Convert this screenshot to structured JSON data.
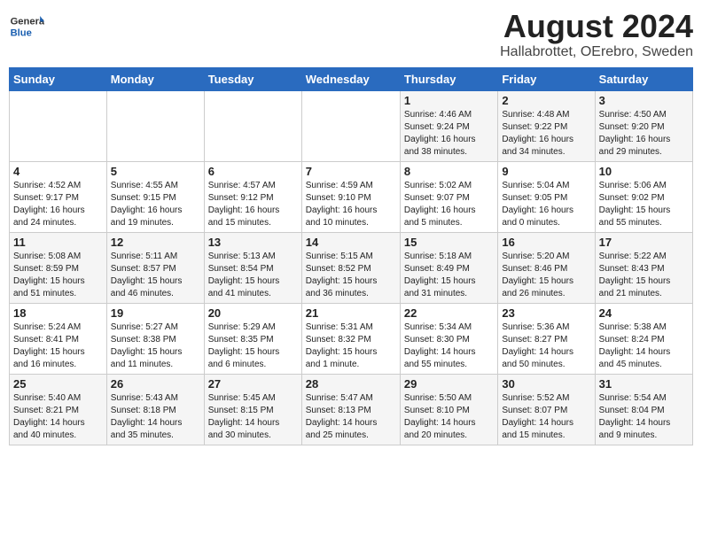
{
  "header": {
    "logo_general": "General",
    "logo_blue": "Blue",
    "title": "August 2024",
    "subtitle": "Hallabrottet, OErebro, Sweden"
  },
  "weekdays": [
    "Sunday",
    "Monday",
    "Tuesday",
    "Wednesday",
    "Thursday",
    "Friday",
    "Saturday"
  ],
  "weeks": [
    [
      {
        "day": "",
        "info": ""
      },
      {
        "day": "",
        "info": ""
      },
      {
        "day": "",
        "info": ""
      },
      {
        "day": "",
        "info": ""
      },
      {
        "day": "1",
        "info": "Sunrise: 4:46 AM\nSunset: 9:24 PM\nDaylight: 16 hours\nand 38 minutes."
      },
      {
        "day": "2",
        "info": "Sunrise: 4:48 AM\nSunset: 9:22 PM\nDaylight: 16 hours\nand 34 minutes."
      },
      {
        "day": "3",
        "info": "Sunrise: 4:50 AM\nSunset: 9:20 PM\nDaylight: 16 hours\nand 29 minutes."
      }
    ],
    [
      {
        "day": "4",
        "info": "Sunrise: 4:52 AM\nSunset: 9:17 PM\nDaylight: 16 hours\nand 24 minutes."
      },
      {
        "day": "5",
        "info": "Sunrise: 4:55 AM\nSunset: 9:15 PM\nDaylight: 16 hours\nand 19 minutes."
      },
      {
        "day": "6",
        "info": "Sunrise: 4:57 AM\nSunset: 9:12 PM\nDaylight: 16 hours\nand 15 minutes."
      },
      {
        "day": "7",
        "info": "Sunrise: 4:59 AM\nSunset: 9:10 PM\nDaylight: 16 hours\nand 10 minutes."
      },
      {
        "day": "8",
        "info": "Sunrise: 5:02 AM\nSunset: 9:07 PM\nDaylight: 16 hours\nand 5 minutes."
      },
      {
        "day": "9",
        "info": "Sunrise: 5:04 AM\nSunset: 9:05 PM\nDaylight: 16 hours\nand 0 minutes."
      },
      {
        "day": "10",
        "info": "Sunrise: 5:06 AM\nSunset: 9:02 PM\nDaylight: 15 hours\nand 55 minutes."
      }
    ],
    [
      {
        "day": "11",
        "info": "Sunrise: 5:08 AM\nSunset: 8:59 PM\nDaylight: 15 hours\nand 51 minutes."
      },
      {
        "day": "12",
        "info": "Sunrise: 5:11 AM\nSunset: 8:57 PM\nDaylight: 15 hours\nand 46 minutes."
      },
      {
        "day": "13",
        "info": "Sunrise: 5:13 AM\nSunset: 8:54 PM\nDaylight: 15 hours\nand 41 minutes."
      },
      {
        "day": "14",
        "info": "Sunrise: 5:15 AM\nSunset: 8:52 PM\nDaylight: 15 hours\nand 36 minutes."
      },
      {
        "day": "15",
        "info": "Sunrise: 5:18 AM\nSunset: 8:49 PM\nDaylight: 15 hours\nand 31 minutes."
      },
      {
        "day": "16",
        "info": "Sunrise: 5:20 AM\nSunset: 8:46 PM\nDaylight: 15 hours\nand 26 minutes."
      },
      {
        "day": "17",
        "info": "Sunrise: 5:22 AM\nSunset: 8:43 PM\nDaylight: 15 hours\nand 21 minutes."
      }
    ],
    [
      {
        "day": "18",
        "info": "Sunrise: 5:24 AM\nSunset: 8:41 PM\nDaylight: 15 hours\nand 16 minutes."
      },
      {
        "day": "19",
        "info": "Sunrise: 5:27 AM\nSunset: 8:38 PM\nDaylight: 15 hours\nand 11 minutes."
      },
      {
        "day": "20",
        "info": "Sunrise: 5:29 AM\nSunset: 8:35 PM\nDaylight: 15 hours\nand 6 minutes."
      },
      {
        "day": "21",
        "info": "Sunrise: 5:31 AM\nSunset: 8:32 PM\nDaylight: 15 hours\nand 1 minute."
      },
      {
        "day": "22",
        "info": "Sunrise: 5:34 AM\nSunset: 8:30 PM\nDaylight: 14 hours\nand 55 minutes."
      },
      {
        "day": "23",
        "info": "Sunrise: 5:36 AM\nSunset: 8:27 PM\nDaylight: 14 hours\nand 50 minutes."
      },
      {
        "day": "24",
        "info": "Sunrise: 5:38 AM\nSunset: 8:24 PM\nDaylight: 14 hours\nand 45 minutes."
      }
    ],
    [
      {
        "day": "25",
        "info": "Sunrise: 5:40 AM\nSunset: 8:21 PM\nDaylight: 14 hours\nand 40 minutes."
      },
      {
        "day": "26",
        "info": "Sunrise: 5:43 AM\nSunset: 8:18 PM\nDaylight: 14 hours\nand 35 minutes."
      },
      {
        "day": "27",
        "info": "Sunrise: 5:45 AM\nSunset: 8:15 PM\nDaylight: 14 hours\nand 30 minutes."
      },
      {
        "day": "28",
        "info": "Sunrise: 5:47 AM\nSunset: 8:13 PM\nDaylight: 14 hours\nand 25 minutes."
      },
      {
        "day": "29",
        "info": "Sunrise: 5:50 AM\nSunset: 8:10 PM\nDaylight: 14 hours\nand 20 minutes."
      },
      {
        "day": "30",
        "info": "Sunrise: 5:52 AM\nSunset: 8:07 PM\nDaylight: 14 hours\nand 15 minutes."
      },
      {
        "day": "31",
        "info": "Sunrise: 5:54 AM\nSunset: 8:04 PM\nDaylight: 14 hours\nand 9 minutes."
      }
    ]
  ]
}
